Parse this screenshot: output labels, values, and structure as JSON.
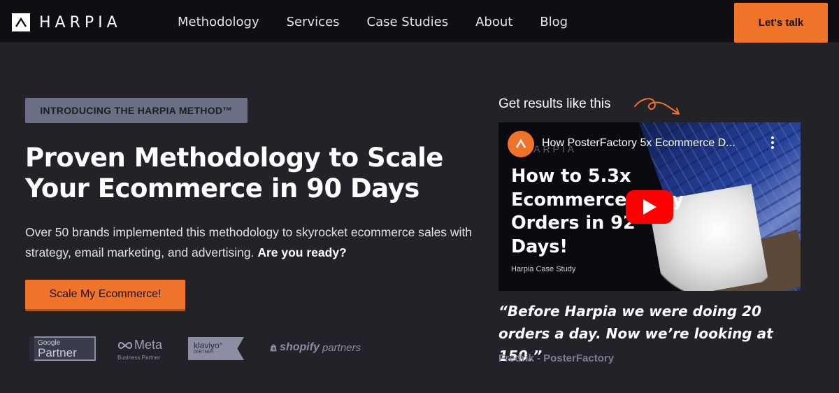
{
  "brand": {
    "logo_text": "HARPIA",
    "accent": "#f0732a"
  },
  "nav": {
    "items": [
      {
        "label": "Methodology"
      },
      {
        "label": "Services"
      },
      {
        "label": "Case Studies"
      },
      {
        "label": "About"
      },
      {
        "label": "Blog"
      }
    ],
    "cta_label": "Let's talk"
  },
  "hero": {
    "badge": "INTRODUCING THE HARPIA METHOD™",
    "title": "Proven Methodology to Scale Your Ecommerce in 90 Days",
    "desc_plain": "Over 50 brands implemented this methodology to skyrocket ecommerce sales with strategy, email marketing, and advertising. ",
    "desc_bold": "Are you ready?",
    "cta_label": "Scale My Ecommerce!"
  },
  "partners": {
    "google_small": "Google",
    "google_large": "Partner",
    "meta_large": "Meta",
    "meta_small": "Business Partner",
    "klaviyo_large": "klaviyo°",
    "klaviyo_small": "PARTNER",
    "shopify_large": "shopify",
    "shopify_small": "partners"
  },
  "results": {
    "label": "Get results like this",
    "video": {
      "title": "How PosterFactory 5x Ecommerce D...",
      "watermark": "HARPIA",
      "headline": "How to 5.3x Ecommerce Daily Orders in 92 Days!",
      "subtitle": "Harpia Case Study",
      "play_color": "#ff0000"
    },
    "quote": "“Before Harpia we were doing 20 orders a day. Now we’re looking at 150.”",
    "author": "Fredrik - PosterFactory"
  }
}
